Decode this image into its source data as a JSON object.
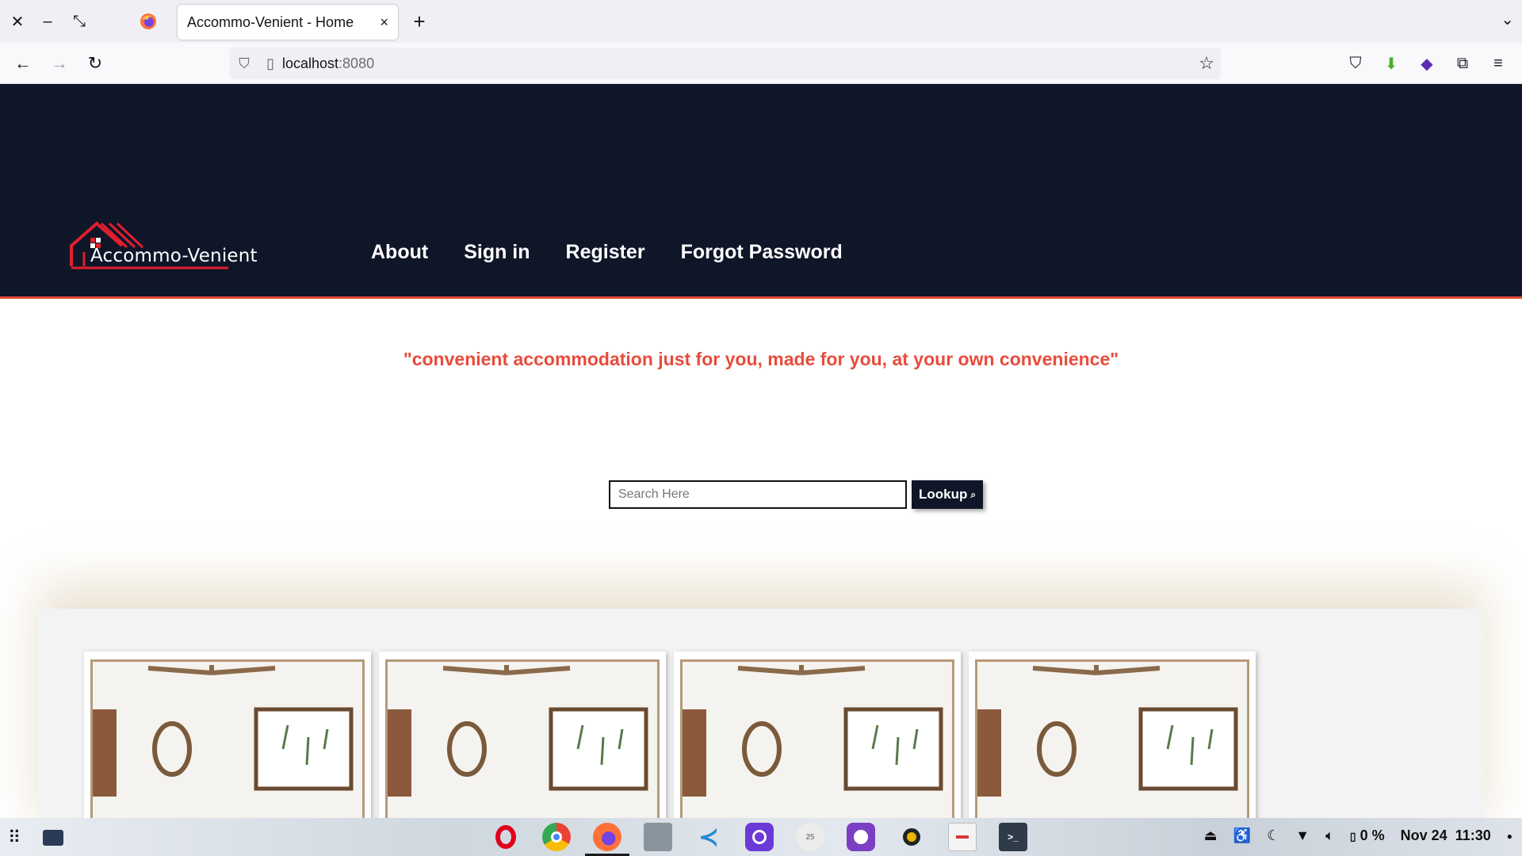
{
  "browser": {
    "window_controls": [
      "×",
      "–",
      "⤡"
    ],
    "tab": {
      "title": "Accommo-Venient - Home",
      "close": "×"
    },
    "new_tab": "+",
    "tab_list": "⌄",
    "url_host": "localhost",
    "url_port": ":8080"
  },
  "site": {
    "logo_text": "Accommo-Venient",
    "nav": [
      "About",
      "Sign in",
      "Register",
      "Forgot Password"
    ],
    "tagline": "\"convenient accommodation just for you, made for you, at your own convenience\"",
    "search": {
      "placeholder": "Search Here",
      "value": "",
      "button_label": "Lookup",
      "button_icon": "⌕"
    },
    "cards_count": 4,
    "colors": {
      "header_bg": "#0f1628",
      "accent": "#e74c3c"
    }
  },
  "taskbar": {
    "apps": [
      "opera",
      "chrome",
      "firefox",
      "files",
      "vscode",
      "tor-browser",
      "clock",
      "github-desktop",
      "rhythmbox",
      "text-editor",
      "terminal"
    ],
    "battery": "0 %",
    "date": "Nov 24",
    "time": "11:30"
  }
}
